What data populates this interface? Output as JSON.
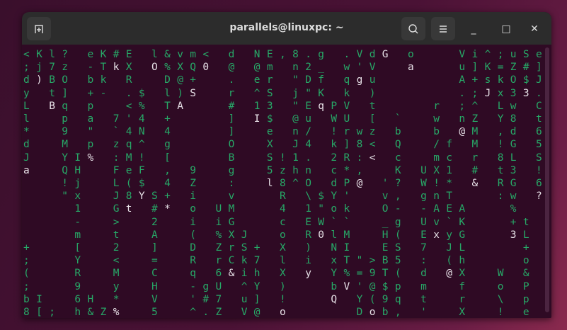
{
  "window": {
    "title": "parallels@linuxpc: ~",
    "new_tab_icon": "new-tab-icon",
    "search_icon": "search-icon",
    "menu_icon": "hamburger-menu-icon",
    "minimize": "_",
    "maximize": "□",
    "close": "✕"
  },
  "colors": {
    "matrix_green": "#27a867",
    "head_white": "#e6e0e6",
    "terminal_bg": "#2f0a24"
  },
  "terminal": {
    "rows": [
      "<Kl? eK#E l&vm< d NE,8.g .VdG o   Vi^;uSe",
      ";j7z -TkX O%XQ0 @ @m n2_ w'V  a   u]K=Z#]",
      "d)BO bk R  D@+  . er \"Df qgu      A+skO$J",
      "y t] +- .$ l)S  r ^S j\"K k )      .;Jx33.",
      "L Bq p  <% TA   # 13 \"EqPV t    r ;^ Lw C",
      "l  p a 7'4 +    ] I$ @u WU [ `  w nZ Y8 t",
      "*  9 \" `4N 4    ]  e n/ !rwz b  b @M ,d 6",
      "d  M p zq^ g    O  X J4 k]8< Q  /f M !G 5",
      "J  YI% :M! [    B  S!1. 2R:< c  mc r 8L S",
      "a  QH  FeF , 9  g  5zhn c*,  K UX1 # t3 !",
      "   !j  L($ 4 Z  :  l8^O dP@ '? W!* & RG 6",
      "   \"x  J8YS+ i  v   R \\$Y'  v, gnT   :w ?",
      "    1  Gt #* o UM   4 1\"ok  O- -AEA   %  ",
      "    -  >  2  i iG   c EW``  _g Uv`K   +t ",
      "    m  t  A  ( %XJ  o R0lM  H( ExyG   3L ",
      "+   [  2  ]  D ZrS+ X ) NI  ES 7 JL    + ",
      ";   Y  <  =  R rCk7 l i xT\">B5 : (h    o ",
      "(   R  M  C  q 6&ih X y Y%=9T( d @X  W & ",
      ";   9  y  H  -gU ^Y )   bV'@$p m  f  o P ",
      "bI  6H *  V  '#7 u] !   Q Y(9q t  r  \\ p ",
      "8[; h&Z%  5  ^.Z V@ o     Dob, '  X  ! e "
    ],
    "heads": [
      [
        0,
        28
      ],
      [
        1,
        7
      ],
      [
        1,
        10
      ],
      [
        1,
        14
      ],
      [
        1,
        30
      ],
      [
        2,
        1
      ],
      [
        2,
        26
      ],
      [
        3,
        13
      ],
      [
        3,
        36
      ],
      [
        3,
        39
      ],
      [
        4,
        2
      ],
      [
        4,
        12
      ],
      [
        4,
        23
      ],
      [
        5,
        18
      ],
      [
        6,
        34
      ],
      [
        8,
        5
      ],
      [
        8,
        27
      ],
      [
        9,
        0
      ],
      [
        10,
        19
      ],
      [
        10,
        26
      ],
      [
        10,
        35
      ],
      [
        11,
        9
      ],
      [
        11,
        40
      ],
      [
        12,
        8
      ],
      [
        12,
        11
      ],
      [
        14,
        23
      ],
      [
        14,
        32
      ],
      [
        14,
        38
      ],
      [
        17,
        16
      ],
      [
        17,
        22
      ],
      [
        17,
        33
      ],
      [
        18,
        25
      ],
      [
        19,
        24
      ],
      [
        20,
        7
      ],
      [
        20,
        20
      ],
      [
        20,
        27
      ]
    ]
  }
}
